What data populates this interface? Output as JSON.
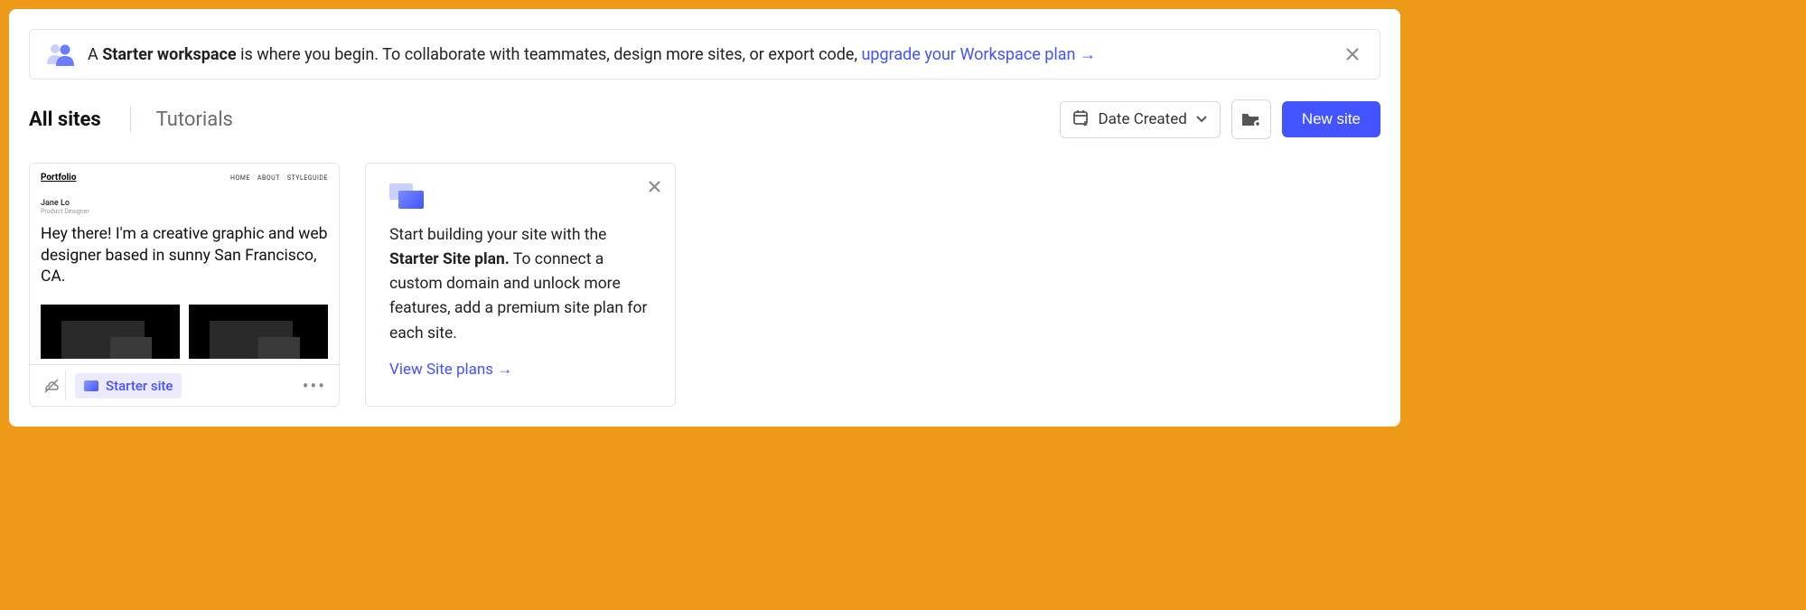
{
  "banner": {
    "prefix": "A ",
    "bold": "Starter workspace",
    "rest": " is where you begin. To collaborate with teammates, design more sites, or export code, ",
    "link": "upgrade your Workspace plan →"
  },
  "tabs": {
    "all_sites": "All sites",
    "tutorials": "Tutorials"
  },
  "toolbar": {
    "sort_label": "Date Created",
    "new_site": "New site"
  },
  "site_card": {
    "thumb": {
      "logo": "Portfolio",
      "nav1": "HOME",
      "nav2": "ABOUT",
      "nav3": "STYLEGUIDE",
      "name": "Jane Lo",
      "role": "Product Designer",
      "desc": "Hey there! I'm a creative graphic and web designer based in sunny San Francisco, CA."
    },
    "badge": "Starter site"
  },
  "promo": {
    "text_before": "Start building your site with the ",
    "text_bold": "Starter Site plan.",
    "text_after": " To connect a custom domain and unlock more features, add a premium site plan for each site.",
    "link": "View Site plans →"
  }
}
